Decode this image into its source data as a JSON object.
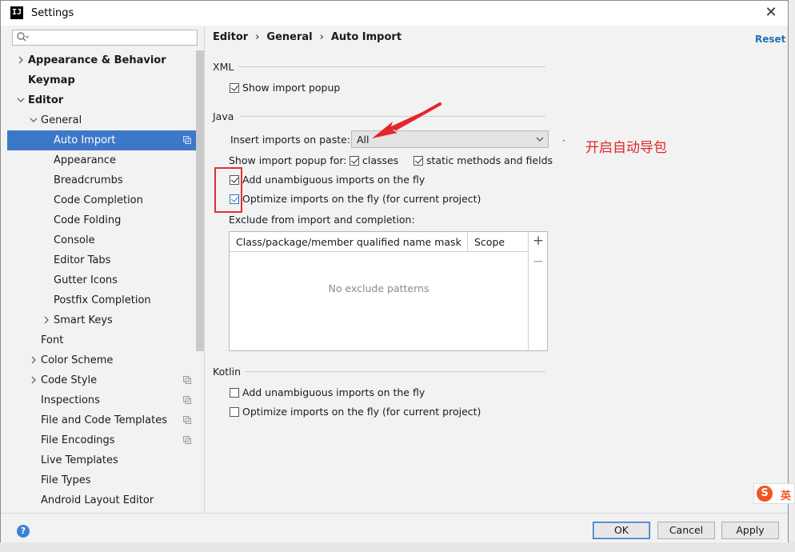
{
  "window": {
    "title": "Settings",
    "logo_text": "IJ"
  },
  "search": {
    "placeholder": ""
  },
  "sidebar": {
    "items": [
      {
        "label": "Appearance & Behavior",
        "level": 0,
        "arrow": "right",
        "bold": true
      },
      {
        "label": "Keymap",
        "level": 0,
        "arrow": "none",
        "bold": true
      },
      {
        "label": "Editor",
        "level": 0,
        "arrow": "down",
        "bold": true
      },
      {
        "label": "General",
        "level": 1,
        "arrow": "down"
      },
      {
        "label": "Auto Import",
        "level": 2,
        "selected": true,
        "copy": true
      },
      {
        "label": "Appearance",
        "level": 2
      },
      {
        "label": "Breadcrumbs",
        "level": 2
      },
      {
        "label": "Code Completion",
        "level": 2
      },
      {
        "label": "Code Folding",
        "level": 2
      },
      {
        "label": "Console",
        "level": 2
      },
      {
        "label": "Editor Tabs",
        "level": 2
      },
      {
        "label": "Gutter Icons",
        "level": 2
      },
      {
        "label": "Postfix Completion",
        "level": 2
      },
      {
        "label": "Smart Keys",
        "level": 2,
        "arrow": "right"
      },
      {
        "label": "Font",
        "level": 1
      },
      {
        "label": "Color Scheme",
        "level": 1,
        "arrow": "right"
      },
      {
        "label": "Code Style",
        "level": 1,
        "arrow": "right",
        "copy": true
      },
      {
        "label": "Inspections",
        "level": 1,
        "copy": true
      },
      {
        "label": "File and Code Templates",
        "level": 1,
        "copy": true
      },
      {
        "label": "File Encodings",
        "level": 1,
        "copy": true
      },
      {
        "label": "Live Templates",
        "level": 1
      },
      {
        "label": "File Types",
        "level": 1
      },
      {
        "label": "Android Layout Editor",
        "level": 1
      }
    ]
  },
  "breadcrumb": {
    "part1": "Editor",
    "part2": "General",
    "part3": "Auto Import",
    "sep": "›"
  },
  "reset_label": "Reset",
  "xml": {
    "title": "XML",
    "show_popup": {
      "label": "Show import popup",
      "checked": true
    }
  },
  "java": {
    "title": "Java",
    "paste_label": "Insert imports on paste:",
    "paste_value": "All",
    "popup_for_label": "Show import popup for:",
    "classes": {
      "label": "classes",
      "checked": true
    },
    "static": {
      "label": "static methods and fields",
      "checked": true
    },
    "add_unambiguous": {
      "label": "Add unambiguous imports on the fly",
      "checked": true
    },
    "optimize": {
      "label": "Optimize imports on the fly (for current project)",
      "checked": true
    },
    "exclude_label": "Exclude from import and completion:",
    "table": {
      "col1": "Class/package/member qualified name mask",
      "col2": "Scope",
      "empty": "No exclude patterns",
      "add_symbol": "+",
      "remove_symbol": "−"
    }
  },
  "kotlin": {
    "title": "Kotlin",
    "add_unambiguous": {
      "label": "Add unambiguous imports on the fly",
      "checked": false
    },
    "optimize": {
      "label": "Optimize imports on the fly (for current project)",
      "checked": false
    }
  },
  "annotation": {
    "text": "开启自动导包",
    "dot": "·",
    "color": "#e1262a"
  },
  "footer": {
    "help": "?",
    "ok": "OK",
    "cancel": "Cancel",
    "apply": "Apply"
  },
  "ime": {
    "logo": "S",
    "lang": "英"
  },
  "colors": {
    "selection": "#3d78c8",
    "link": "#2470b3",
    "annotation_red": "#e03030",
    "ime_orange": "#f25424"
  }
}
